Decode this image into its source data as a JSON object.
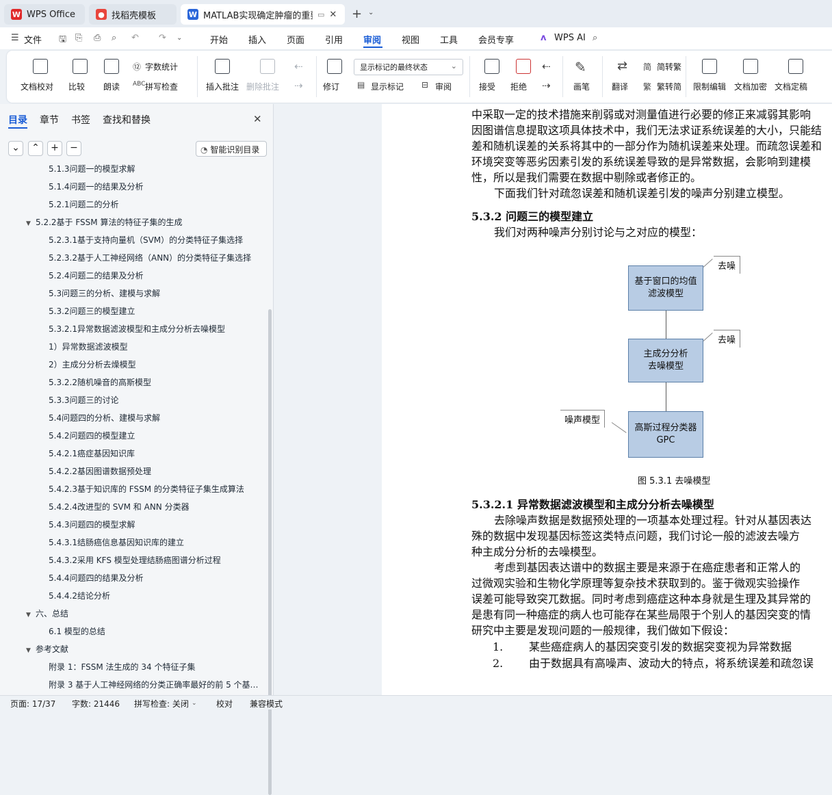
{
  "tabs": [
    {
      "label": "WPS Office"
    },
    {
      "label": "找稻壳模板"
    },
    {
      "label": "MATLAB实现确定肿瘤的重要"
    }
  ],
  "menu": {
    "file": "文件",
    "items": [
      "开始",
      "插入",
      "页面",
      "引用",
      "审阅",
      "视图",
      "工具",
      "会员专享"
    ],
    "active": "审阅",
    "wps_ai": "WPS AI"
  },
  "ribbon": {
    "doc_check": "文档校对",
    "compare": "比较",
    "read_aloud": "朗读",
    "word_count": "字数统计",
    "spell_check": "拼写检查",
    "insert_comment": "插入批注",
    "delete_comment": "删除批注",
    "revise": "修订",
    "markup_state": "显示标记的最终状态",
    "show_markup": "显示标记",
    "review": "审阅",
    "accept": "接受",
    "reject": "拒绝",
    "pen": "画笔",
    "translate": "翻译",
    "to_trad": "简转繁",
    "to_simp": "繁转简",
    "restrict": "限制编辑",
    "encrypt": "文档加密",
    "finalize": "文档定稿"
  },
  "sidebar": {
    "tabs": [
      "目录",
      "章节",
      "书签",
      "查找和替换"
    ],
    "smart_btn": "智能识别目录",
    "toc": [
      {
        "label": "5.1.3问题一的模型求解",
        "level": 2
      },
      {
        "label": "5.1.4问题一的结果及分析",
        "level": 2
      },
      {
        "label": "5.2.1问题二的分析",
        "level": 2
      },
      {
        "label": "5.2.2基于 FSSM 算法的特征子集的生成",
        "level": 1,
        "expand": true
      },
      {
        "label": "5.2.3.1基于支持向量机（SVM）的分类特征子集选择",
        "level": 2
      },
      {
        "label": "5.2.3.2基于人工神经网络（ANN）的分类特征子集选择",
        "level": 2
      },
      {
        "label": "5.2.4问题二的结果及分析",
        "level": 2
      },
      {
        "label": "5.3问题三的分析、建模与求解",
        "level": 2
      },
      {
        "label": "5.3.2问题三的模型建立",
        "level": 2
      },
      {
        "label": "5.3.2.1异常数据滤波模型和主成分分析去噪模型",
        "level": 2
      },
      {
        "label": "1）异常数据滤波模型",
        "level": 2
      },
      {
        "label": "2）主成分分析去燥模型",
        "level": 2
      },
      {
        "label": "5.3.2.2随机噪音的高斯模型",
        "level": 2
      },
      {
        "label": "5.3.3问题三的讨论",
        "level": 2
      },
      {
        "label": "5.4问题四的分析、建模与求解",
        "level": 2
      },
      {
        "label": "5.4.2问题四的模型建立",
        "level": 2
      },
      {
        "label": "5.4.2.1癌症基因知识库",
        "level": 2
      },
      {
        "label": "5.4.2.2基因图谱数据预处理",
        "level": 2
      },
      {
        "label": "5.4.2.3基于知识库的 FSSM 的分类特征子集生成算法",
        "level": 2
      },
      {
        "label": "5.4.2.4改进型的 SVM 和 ANN 分类器",
        "level": 2
      },
      {
        "label": "5.4.3问题四的模型求解",
        "level": 2
      },
      {
        "label": "5.4.3.1结肠癌信息基因知识库的建立",
        "level": 2
      },
      {
        "label": "5.4.3.2采用 KFS 模型处理结肠癌图谱分析过程",
        "level": 2
      },
      {
        "label": "5.4.4问题四的结果及分析",
        "level": 2
      },
      {
        "label": "5.4.4.2结论分析",
        "level": 2
      },
      {
        "label": "六、总结",
        "level": 1,
        "expand": true
      },
      {
        "label": "6.1 模型的总结",
        "level": 2
      },
      {
        "label": "参考文献",
        "level": 1,
        "expand": true
      },
      {
        "label": "附录 1：FSSM 法生成的 34 个特征子集",
        "level": 2
      },
      {
        "label": "附录 3 基于人工神经网络的分类正确率最好的前 5 个基…",
        "level": 2
      }
    ]
  },
  "doc": {
    "lines1": [
      "中采取一定的技术措施来削弱或对测量值进行必要的修正来减弱其影响",
      "因图谱信息提取这项具体技术中，我们无法求证系统误差的大小，只能结",
      "差和随机误差的关系将其中的一部分作为随机误差来处理。而疏忽误差和",
      "环境突变等恶劣因素引发的系统误差导致的是异常数据，会影响到建模",
      "性，所以是我们需要在数据中剔除或者修正的。"
    ],
    "para2": "下面我们针对疏忽误差和随机误差引发的噪声分别建立模型。",
    "h1": "5.3.2  问题三的模型建立",
    "para3": "我们对两种噪声分别讨论与之对应的模型：",
    "diagram": {
      "box1": [
        "基于窗口的均值",
        "滤波模型"
      ],
      "box2": [
        "主成分分析",
        "去噪模型"
      ],
      "box3": [
        "高斯过程分类器",
        "GPC"
      ],
      "call1": "去噪",
      "call2": "去噪",
      "call3": "噪声模型"
    },
    "caption": "图  5.3.1  去噪模型",
    "h2": "5.3.2.1 异常数据滤波模型和主成分分析去噪模型",
    "lines2": [
      "去除噪声数据是数据预处理的一项基本处理过程。针对从基因表达",
      "殊的数据中发现基因标签这类特点问题，我们讨论一般的滤波去噪方",
      "种主成分分析的去噪模型。"
    ],
    "lines3": [
      "考虑到基因表达谱中的数据主要是来源于在癌症患者和正常人的",
      "过微观实验和生物化学原理等复杂技术获取到的。鉴于微观实验操作",
      "误差可能导致突兀数据。同时考虑到癌症这种本身就是生理及其异常的",
      "是患有同一种癌症的病人也可能存在某些局限于个别人的基因突变的情",
      "研究中主要是发现问题的一般规律，我们做如下假设："
    ],
    "list": [
      {
        "num": "1.",
        "text": "某些癌症病人的基因突变引发的数据突变视为异常数据"
      },
      {
        "num": "2.",
        "text": "由于数据具有高噪声、波动大的特点，将系统误差和疏忽误"
      }
    ]
  },
  "status": {
    "page": "页面: 17/37",
    "words": "字数: 21446",
    "spell": "拼写检查: 关闭",
    "proof": "校对",
    "compat": "兼容模式"
  }
}
